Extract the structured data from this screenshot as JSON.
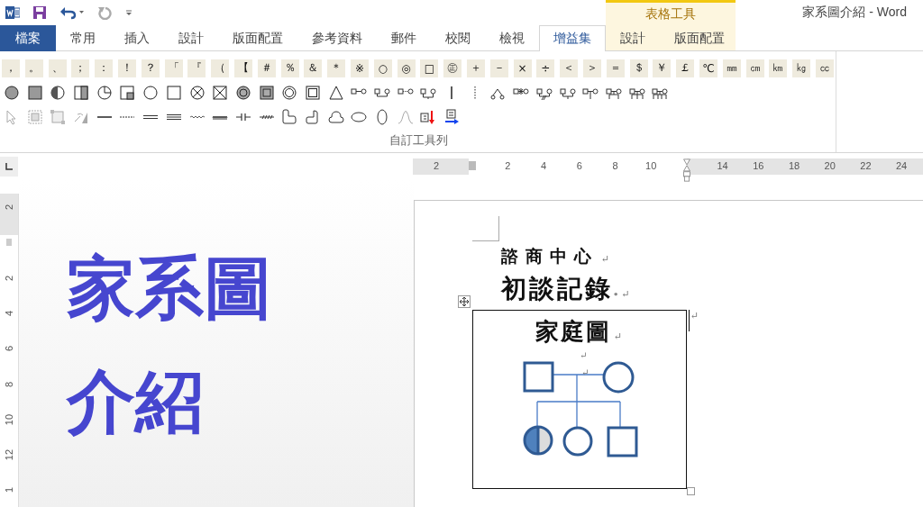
{
  "title_bar": {
    "title": "家系圖介紹 - Word",
    "context_group": "表格工具"
  },
  "tabs": [
    {
      "label": "檔案",
      "kind": "file",
      "selected": false
    },
    {
      "label": "常用",
      "kind": "normal",
      "selected": false
    },
    {
      "label": "插入",
      "kind": "normal",
      "selected": false
    },
    {
      "label": "設計",
      "kind": "normal",
      "selected": false
    },
    {
      "label": "版面配置",
      "kind": "normal",
      "selected": false
    },
    {
      "label": "參考資料",
      "kind": "normal",
      "selected": false
    },
    {
      "label": "郵件",
      "kind": "normal",
      "selected": false
    },
    {
      "label": "校閱",
      "kind": "normal",
      "selected": false
    },
    {
      "label": "檢視",
      "kind": "normal",
      "selected": false
    },
    {
      "label": "增益集",
      "kind": "normal",
      "selected": true
    },
    {
      "label": "設計",
      "kind": "context",
      "selected": false
    },
    {
      "label": "版面配置",
      "kind": "context",
      "selected": false
    }
  ],
  "ribbon": {
    "symbols": [
      "，",
      "。",
      "、",
      "；",
      "：",
      "！",
      "？",
      "「",
      "『",
      "（",
      "【",
      "＃",
      "％",
      "＆",
      "＊",
      "※",
      "○",
      "◎",
      "□",
      "㊣",
      "＋",
      "－",
      "×",
      "÷",
      "＜",
      "＞",
      "＝",
      "＄",
      "￥",
      "￡",
      "℃",
      "㎜",
      "㎝",
      "㎞",
      "㎏",
      "㏄"
    ],
    "group_label": "自訂工具列"
  },
  "ruler": {
    "horizontal": [
      {
        "kind": "number",
        "label": "2"
      },
      {
        "kind": "margin"
      },
      {
        "kind": "number",
        "label": "2"
      },
      {
        "kind": "number",
        "label": "4"
      },
      {
        "kind": "number",
        "label": "6"
      },
      {
        "kind": "number",
        "label": "8"
      },
      {
        "kind": "number",
        "label": "10"
      },
      {
        "kind": "indent"
      },
      {
        "kind": "number",
        "label": "14"
      },
      {
        "kind": "number",
        "label": "16"
      },
      {
        "kind": "number",
        "label": "18"
      },
      {
        "kind": "number",
        "label": "20"
      },
      {
        "kind": "number",
        "label": "22"
      },
      {
        "kind": "number",
        "label": "24"
      }
    ],
    "vertical": [
      {
        "kind": "number",
        "label": "2"
      },
      {
        "kind": "margin"
      },
      {
        "kind": "number",
        "label": "2"
      },
      {
        "kind": "number",
        "label": "4"
      },
      {
        "kind": "number",
        "label": "6"
      },
      {
        "kind": "number",
        "label": "8"
      },
      {
        "kind": "number",
        "label": "10"
      },
      {
        "kind": "number",
        "label": "12"
      },
      {
        "kind": "number",
        "label": "1"
      }
    ]
  },
  "overlay": {
    "lines": [
      "家系圖",
      "介紹"
    ]
  },
  "document": {
    "heading": {
      "text": "諮商中心",
      "mark": "↵"
    },
    "title": {
      "text": "初談記錄",
      "dot": "•",
      "mark": "↵"
    },
    "table": {
      "title": "家庭圖",
      "title_mark": "↵",
      "marks": [
        "↵",
        "↵"
      ],
      "row_end_mark": "↵"
    }
  }
}
